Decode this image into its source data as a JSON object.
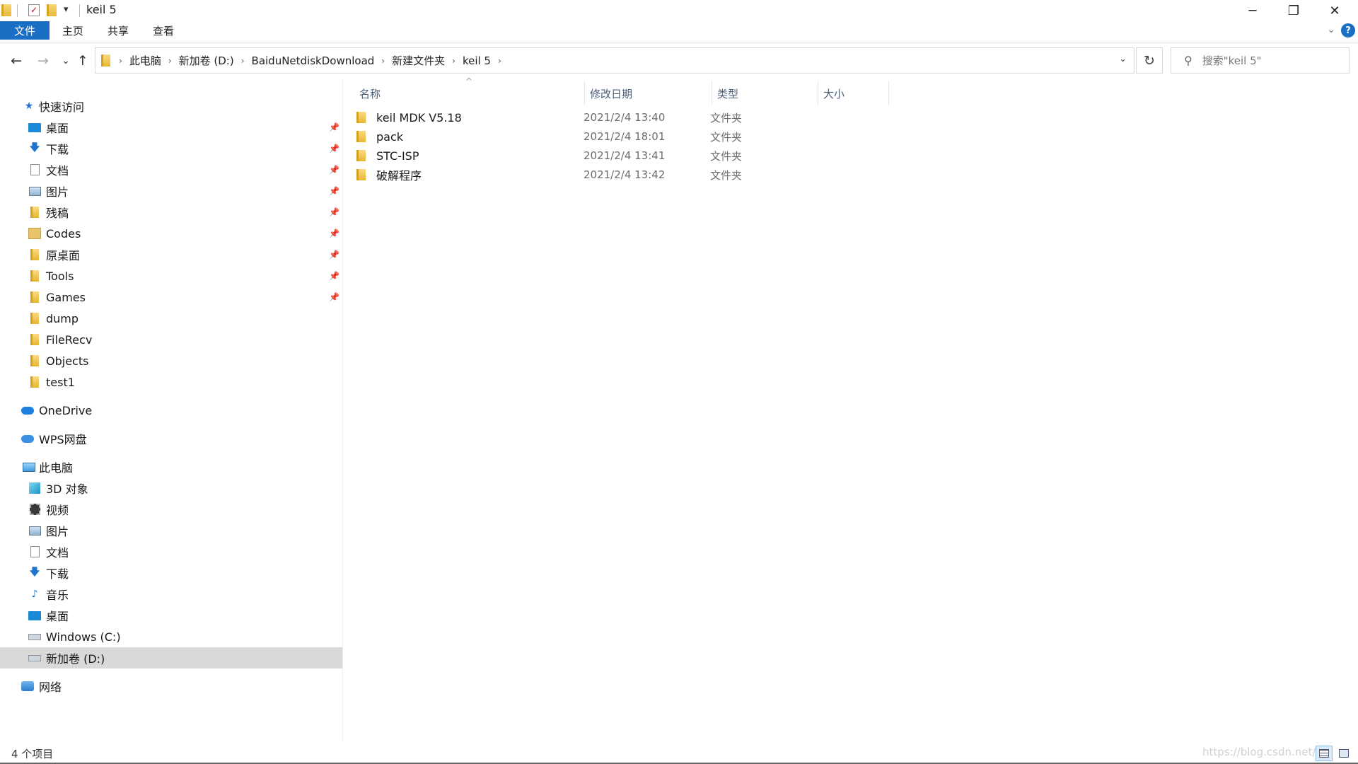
{
  "window": {
    "title": "keil 5",
    "minimize": "─",
    "restore": "❐",
    "close": "✕"
  },
  "quick_access_toolbar": {
    "dropdown": "▾"
  },
  "ribbon": {
    "tabs": [
      {
        "label": "文件",
        "active": true
      },
      {
        "label": "主页",
        "active": false
      },
      {
        "label": "共享",
        "active": false
      },
      {
        "label": "查看",
        "active": false
      }
    ],
    "expand_chevron": "⌄",
    "help": "?"
  },
  "navigation": {
    "back": "←",
    "forward": "→",
    "recent": "⌄",
    "up": "↑",
    "breadcrumbs": [
      "此电脑",
      "新加卷 (D:)",
      "BaiduNetdiskDownload",
      "新建文件夹",
      "keil 5"
    ],
    "crumb_separator": "›",
    "address_dropdown": "⌄",
    "refresh": "↻",
    "search_placeholder": "搜索\"keil 5\""
  },
  "sidebar": {
    "quick_access": {
      "label": "快速访问",
      "items": [
        {
          "label": "桌面",
          "icon": "desktop-icon",
          "pinned": true
        },
        {
          "label": "下载",
          "icon": "download-icon",
          "pinned": true
        },
        {
          "label": "文档",
          "icon": "document-icon",
          "pinned": true
        },
        {
          "label": "图片",
          "icon": "pictures-icon",
          "pinned": true
        },
        {
          "label": "残稿",
          "icon": "folder-icon",
          "pinned": true
        },
        {
          "label": "Codes",
          "icon": "folder-icon",
          "pinned": true
        },
        {
          "label": "原桌面",
          "icon": "folder-icon",
          "pinned": true
        },
        {
          "label": "Tools",
          "icon": "folder-icon",
          "pinned": true
        },
        {
          "label": "Games",
          "icon": "folder-icon",
          "pinned": true
        },
        {
          "label": "dump",
          "icon": "folder-icon",
          "pinned": false
        },
        {
          "label": "FileRecv",
          "icon": "folder-icon",
          "pinned": false
        },
        {
          "label": "Objects",
          "icon": "folder-icon",
          "pinned": false
        },
        {
          "label": "test1",
          "icon": "folder-icon",
          "pinned": false
        }
      ]
    },
    "onedrive": {
      "label": "OneDrive"
    },
    "wps": {
      "label": "WPS网盘"
    },
    "this_pc": {
      "label": "此电脑",
      "items": [
        {
          "label": "3D 对象",
          "icon": "3d-objects-icon"
        },
        {
          "label": "视频",
          "icon": "video-icon"
        },
        {
          "label": "图片",
          "icon": "pictures-icon"
        },
        {
          "label": "文档",
          "icon": "document-icon"
        },
        {
          "label": "下载",
          "icon": "download-icon"
        },
        {
          "label": "音乐",
          "icon": "music-icon"
        },
        {
          "label": "桌面",
          "icon": "desktop-icon"
        },
        {
          "label": "Windows (C:)",
          "icon": "drive-icon"
        },
        {
          "label": "新加卷 (D:)",
          "icon": "drive-icon",
          "selected": true
        }
      ]
    },
    "network": {
      "label": "网络"
    },
    "pin_glyph": "📌"
  },
  "file_list": {
    "sort_indicator": "^",
    "columns": {
      "name": "名称",
      "modified": "修改日期",
      "type": "类型",
      "size": "大小"
    },
    "rows": [
      {
        "name": "keil MDK V5.18",
        "modified": "2021/2/4 13:40",
        "type": "文件夹"
      },
      {
        "name": "pack",
        "modified": "2021/2/4 18:01",
        "type": "文件夹"
      },
      {
        "name": "STC-ISP",
        "modified": "2021/2/4 13:41",
        "type": "文件夹"
      },
      {
        "name": "破解程序",
        "modified": "2021/2/4 13:42",
        "type": "文件夹"
      }
    ]
  },
  "status": {
    "count": "4 个项目",
    "watermark": "https://blog.csdn.net/..."
  },
  "colors": {
    "accent": "#1a6fc4",
    "folder": "#e6b533",
    "selected_bg": "#d9d9d9"
  }
}
